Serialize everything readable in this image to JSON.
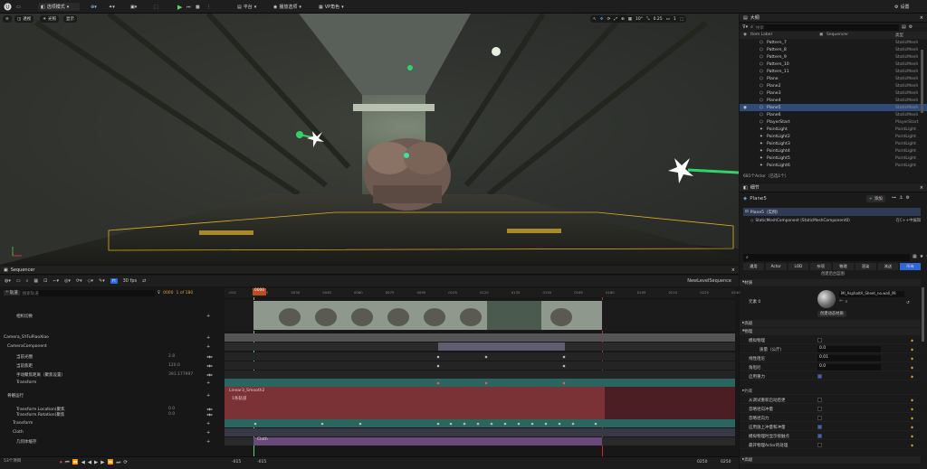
{
  "toolbar": {
    "mode_label": "选项模式",
    "platform_label": "平台",
    "play_label": "播放选项",
    "vp_label": "VP角色",
    "settings_label": "设置"
  },
  "viewport": {
    "perspective_label": "透视",
    "lit_label": "光照",
    "show_label": "显示",
    "snap_angle": "10°",
    "snap_scale": "0.25",
    "camera_speed": "1"
  },
  "outliner": {
    "title": "大纲",
    "search_placeholder": "搜索",
    "col_label": "Item Label",
    "col_seq": "Sequencer",
    "col_type": "类型",
    "rows": [
      {
        "name": "Pattern_7",
        "type": "StaticMesh"
      },
      {
        "name": "Pattern_8",
        "type": "StaticMesh"
      },
      {
        "name": "Pattern_9",
        "type": "StaticMesh"
      },
      {
        "name": "Pattern_10",
        "type": "StaticMesh"
      },
      {
        "name": "Pattern_11",
        "type": "StaticMesh"
      },
      {
        "name": "Plane",
        "type": "StaticMesh"
      },
      {
        "name": "Plane2",
        "type": "StaticMesh"
      },
      {
        "name": "Plane3",
        "type": "StaticMesh"
      },
      {
        "name": "Plane4",
        "type": "StaticMesh"
      },
      {
        "name": "Plane5",
        "type": "StaticMesh"
      },
      {
        "name": "Plane6",
        "type": "StaticMesh"
      },
      {
        "name": "PlayerStart",
        "type": "PlayerStart"
      },
      {
        "name": "PointLight",
        "type": "PointLight"
      },
      {
        "name": "PointLight2",
        "type": "PointLight"
      },
      {
        "name": "PointLight3",
        "type": "PointLight"
      },
      {
        "name": "PointLight4",
        "type": "PointLight"
      },
      {
        "name": "PointLight5",
        "type": "PointLight"
      },
      {
        "name": "PointLight6",
        "type": "PointLight"
      }
    ],
    "selected_index": 9,
    "footer": "681个Actor（已选1个）"
  },
  "details": {
    "title": "细节",
    "actor_name": "Plane5",
    "add_label": "添加",
    "instance_label": "Plane5（实例）",
    "component_label": "StaticMeshComponent (StaticMeshComponent0)",
    "cpp_label": "在C++中编辑",
    "blueprint_label": "创建后台蓝图",
    "tabs": [
      "通用",
      "Actor",
      "LOD",
      "杂项",
      "物理",
      "渲染",
      "流送",
      "所有"
    ],
    "active_tab": 7,
    "section_material": "材质",
    "element_label": "元素 0",
    "material_name": "MI_AsphaltA_Sheet_no.wall_Mi",
    "create_dynamic_label": "创建动态材质",
    "section_effects": "高级",
    "section_physics": "物理",
    "props": [
      {
        "label": "模拟物理",
        "value": ""
      },
      {
        "label": "质量（公斤）",
        "value": "0.0"
      },
      {
        "label": "线性阻尼",
        "value": "0.01"
      },
      {
        "label": "角阻尼",
        "value": "0.0"
      },
      {
        "label": "启用重力",
        "value": ""
      }
    ],
    "section_constraints": "约束",
    "flags": [
      "从调试重新启动后更",
      "忽略径向冲量",
      "忽略径向力",
      "应用施上冲量和冲量",
      "模拟物理时显示接触点",
      "最开物理Actor的处理"
    ],
    "section_collision": "高级"
  },
  "sequencer": {
    "title": "Sequencer",
    "track_label": "轨道",
    "search_placeholder": "搜索轨道",
    "frame_current": "0000",
    "frame_range": "1 of 180",
    "fps_label": "30 fps",
    "sequence_name": "NewLevelSequence",
    "playhead_label": "0000",
    "ruler": [
      "-015",
      "0015",
      "0030",
      "0045",
      "0060",
      "0075",
      "0090",
      "0105",
      "0120",
      "0135",
      "0150",
      "0165",
      "0180",
      "0195",
      "0210",
      "0225",
      "0240"
    ],
    "tracks": [
      {
        "label": "相机切换"
      },
      {
        "label": "Camera_SYFuPiaoXiao"
      },
      {
        "label": "CameraComponent"
      },
      {
        "label": "当前光圈",
        "value": "2.8"
      },
      {
        "label": "当前焦距",
        "value": "120.0"
      },
      {
        "label": "手动聚焦距离（聚焦设置）",
        "value": "391.177997"
      },
      {
        "label": "Transform"
      },
      {
        "label": "骨骼运行"
      },
      {
        "label": "Transform.Location(聚焦",
        "value": "0.0"
      },
      {
        "label": "Transform.Rotation(聚焦",
        "value": "0.0"
      },
      {
        "label": "Transform"
      },
      {
        "label": "Cloth"
      },
      {
        "label": "几何体缓存"
      }
    ],
    "item_count": "53个项目",
    "section_lower": "Linear3_Smooth2",
    "section_lower2": "1条轨道",
    "cloth_label": "Cloth",
    "bottom_left": "-015",
    "bottom_left2": "-015",
    "bottom_right": "0250",
    "bottom_right2": "0250"
  }
}
